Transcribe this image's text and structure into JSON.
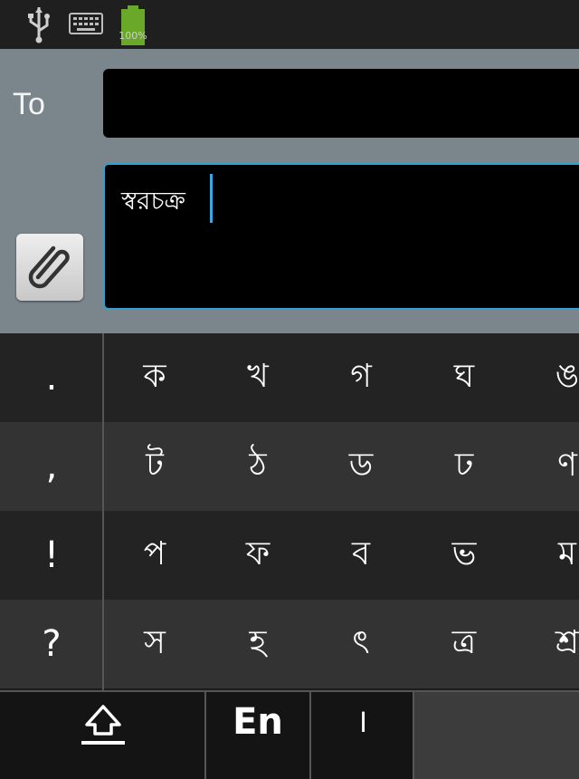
{
  "status_bar": {
    "icons": [
      "usb-icon",
      "keyboard-icon",
      "battery-icon"
    ],
    "battery_label": "100%"
  },
  "compose": {
    "to_label": "To",
    "to_value": "",
    "message_text": "স্বরচক্র",
    "attach_icon": "paperclip-icon",
    "accent_color": "#2f9fd6"
  },
  "keyboard": {
    "punctuation": [
      ".",
      ",",
      "!",
      "?"
    ],
    "rows": [
      [
        "ক",
        "খ",
        "গ",
        "ঘ",
        "ঙ"
      ],
      [
        "ট",
        "ঠ",
        "ড",
        "ঢ",
        "ণ"
      ],
      [
        "প",
        "ফ",
        "ব",
        "ভ",
        "ম"
      ],
      [
        "স",
        "হ",
        "ৎ",
        "ত্র",
        "শ্র"
      ]
    ],
    "bottom": {
      "shift_icon": "shift-icon",
      "lang_label": "En",
      "danda_label": "।"
    }
  }
}
